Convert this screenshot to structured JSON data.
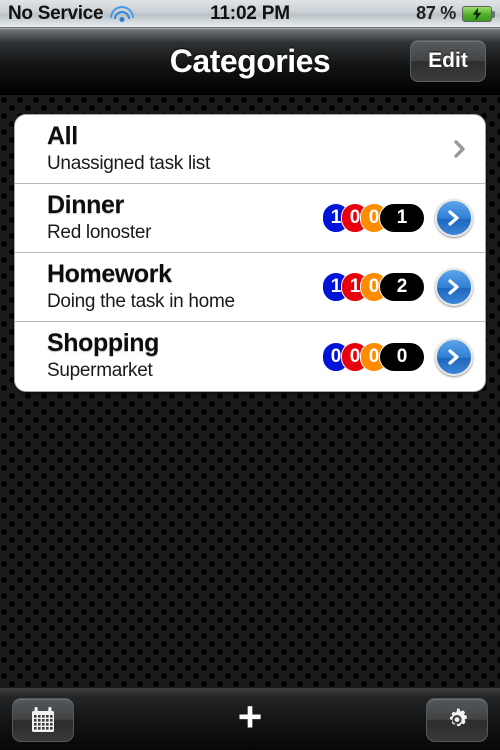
{
  "statusbar": {
    "carrier": "No Service",
    "wifi_icon": "wifi-icon",
    "time": "11:02 PM",
    "battery_percent": "87 %",
    "battery_icon": "battery-charging-icon"
  },
  "navbar": {
    "title": "Categories",
    "edit_label": "Edit"
  },
  "list": {
    "rows": [
      {
        "title": "All",
        "subtitle": "Unassigned task list",
        "accessory": "gray-chevron",
        "badges": []
      },
      {
        "title": "Dinner",
        "subtitle": "Red lonoster",
        "accessory": "blue-disclosure",
        "badges": [
          {
            "color_name": "blue",
            "color": "#0013d8",
            "value": "1"
          },
          {
            "color_name": "red",
            "color": "#e8000c",
            "value": "0"
          },
          {
            "color_name": "orange",
            "color": "#ff8c00",
            "value": "0"
          },
          {
            "color_name": "black",
            "color": "#000000",
            "value": "1"
          }
        ]
      },
      {
        "title": "Homework",
        "subtitle": "Doing the task in home",
        "accessory": "blue-disclosure",
        "badges": [
          {
            "color_name": "blue",
            "color": "#0013d8",
            "value": "1"
          },
          {
            "color_name": "red",
            "color": "#e8000c",
            "value": "1"
          },
          {
            "color_name": "orange",
            "color": "#ff8c00",
            "value": "0"
          },
          {
            "color_name": "black",
            "color": "#000000",
            "value": "2"
          }
        ]
      },
      {
        "title": "Shopping",
        "subtitle": "Supermarket",
        "accessory": "blue-disclosure",
        "badges": [
          {
            "color_name": "blue",
            "color": "#0013d8",
            "value": "0"
          },
          {
            "color_name": "red",
            "color": "#e8000c",
            "value": "0"
          },
          {
            "color_name": "orange",
            "color": "#ff8c00",
            "value": "0"
          },
          {
            "color_name": "black",
            "color": "#000000",
            "value": "0"
          }
        ]
      }
    ]
  },
  "toolbar": {
    "calendar_icon": "calendar-icon",
    "add_icon": "plus-icon",
    "add_label": "+",
    "settings_icon": "gear-icon"
  }
}
